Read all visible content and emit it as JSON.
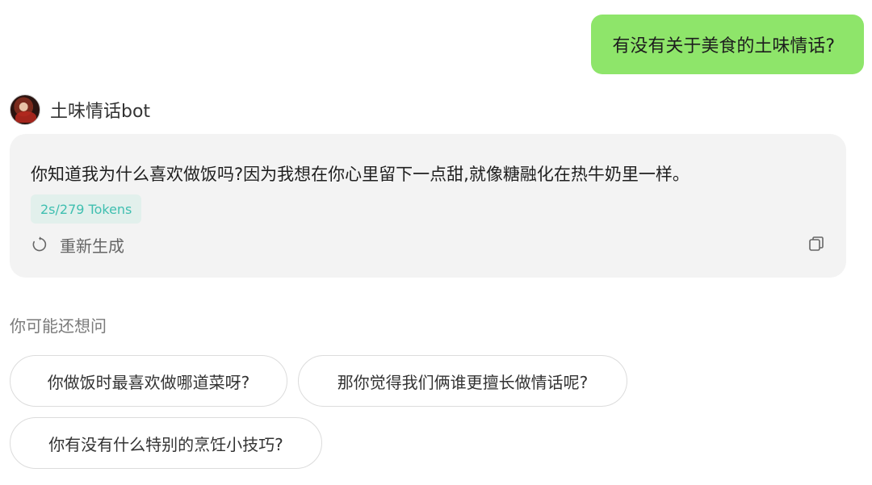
{
  "user_message": "有没有关于美食的土味情话?",
  "bot": {
    "name": "土味情话bot",
    "reply": "你知道我为什么喜欢做饭吗?因为我想在你心里留下一点甜,就像糖融化在热牛奶里一样。",
    "token_info": "2s/279 Tokens",
    "regenerate_label": "重新生成",
    "icons": {
      "regenerate": "refresh-icon",
      "copy": "copy-icon"
    }
  },
  "suggestions": {
    "title": "你可能还想问",
    "items": [
      "你做饭时最喜欢做哪道菜呀?",
      "那你觉得我们俩谁更擅长做情话呢?",
      "你有没有什么特别的烹饪小技巧?"
    ]
  },
  "colors": {
    "user_bubble": "#8ee56a",
    "bot_card": "#f3f3f3",
    "token_badge_bg": "#e2f0ec",
    "token_badge_text": "#3fbfb0"
  }
}
